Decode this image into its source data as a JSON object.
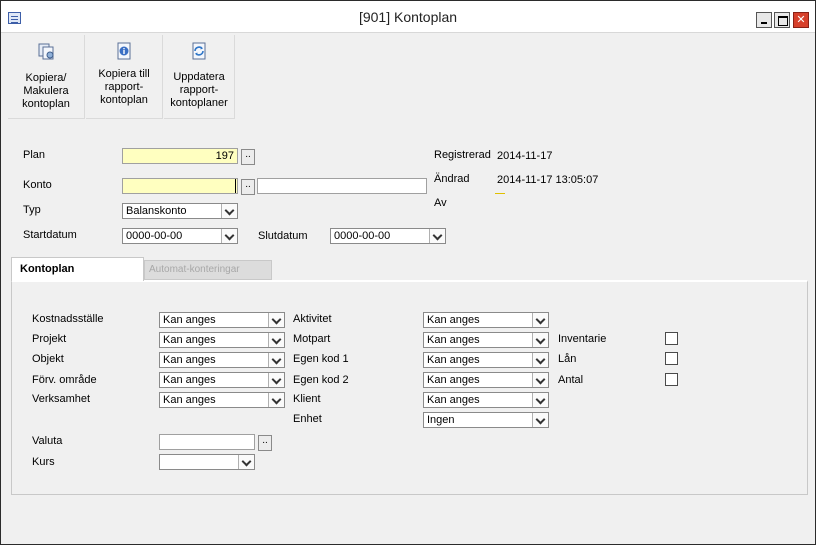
{
  "window": {
    "title": "[901]  Kontoplan"
  },
  "toolbar": {
    "copy_void": [
      "Kopiera/",
      "Makulera",
      "kontoplan"
    ],
    "copy_report": [
      "Kopiera till",
      "rapport-",
      "kontoplan"
    ],
    "update_report": [
      "Uppdatera",
      "rapport-",
      "kontoplaner"
    ]
  },
  "form": {
    "plan_label": "Plan",
    "plan_value": "197",
    "konto_label": "Konto",
    "konto_value": "",
    "konto_name": "",
    "typ_label": "Typ",
    "typ_value": "Balanskonto",
    "startdatum_label": "Startdatum",
    "startdatum_value": "0000-00-00",
    "slutdatum_label": "Slutdatum",
    "slutdatum_value": "0000-00-00",
    "registrerad_label": "Registrerad",
    "registrerad_value": "2014-11-17",
    "andrad_label": "Ändrad",
    "andrad_value": "2014-11-17 13:05:07",
    "av_label": "Av"
  },
  "tabs": {
    "kontoplan": "Kontoplan",
    "automat": "Automat-konteringar"
  },
  "panel": {
    "kostnadsstalle_label": "Kostnadsställe",
    "kostnadsstalle_value": "Kan anges",
    "projekt_label": "Projekt",
    "projekt_value": "Kan anges",
    "objekt_label": "Objekt",
    "objekt_value": "Kan anges",
    "forv_label": "Förv. område",
    "forv_value": "Kan anges",
    "verksamhet_label": "Verksamhet",
    "verksamhet_value": "Kan anges",
    "aktivitet_label": "Aktivitet",
    "aktivitet_value": "Kan anges",
    "motpart_label": "Motpart",
    "motpart_value": "Kan anges",
    "egen1_label": "Egen kod 1",
    "egen1_value": "Kan anges",
    "egen2_label": "Egen kod 2",
    "egen2_value": "Kan anges",
    "klient_label": "Klient",
    "klient_value": "Kan anges",
    "enhet_label": "Enhet",
    "enhet_value": "Ingen",
    "inventarie_label": "Inventarie",
    "lan_label": "Lån",
    "antal_label": "Antal",
    "valuta_label": "Valuta",
    "valuta_value": "",
    "kurs_label": "Kurs",
    "kurs_value": ""
  }
}
